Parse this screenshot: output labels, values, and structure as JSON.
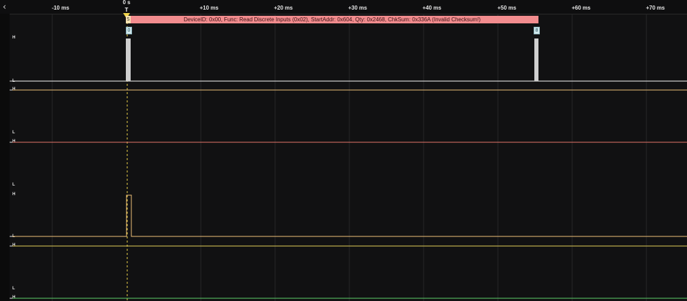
{
  "ruler": {
    "back_icon": "chevron-left-icon",
    "zero_label": "0 s",
    "trigger_label": "T",
    "ticks": [
      "-10 ms",
      "+10 ms",
      "+20 ms",
      "+30 ms",
      "+40 ms",
      "+50 ms",
      "+60 ms",
      "+70 ms"
    ]
  },
  "decoder": {
    "start_marker": "S",
    "frame_text": "DeviceID: 0x00, Func: Read Discrete Inputs (0x02), StartAddr: 0x604, Qty: 0x2468, ChkSum: 0x336A (Invalid Checksum!)",
    "byte_start": "0",
    "byte_end": "8",
    "color": "#f28c8e"
  },
  "channels": [
    {
      "high": "H",
      "low": "L",
      "color": "#ffffff"
    },
    {
      "high": "H",
      "low": "L",
      "color": "#f1c27a"
    },
    {
      "high": "H",
      "low": "L",
      "color": "#e8776a"
    },
    {
      "high": "H",
      "low": "L",
      "color": "#f1c27a"
    },
    {
      "high": "H",
      "low": "L",
      "color": "#e6d35a"
    },
    {
      "high": "H",
      "color": "#5fd36a"
    }
  ],
  "trigger_color": "#f0d54a"
}
